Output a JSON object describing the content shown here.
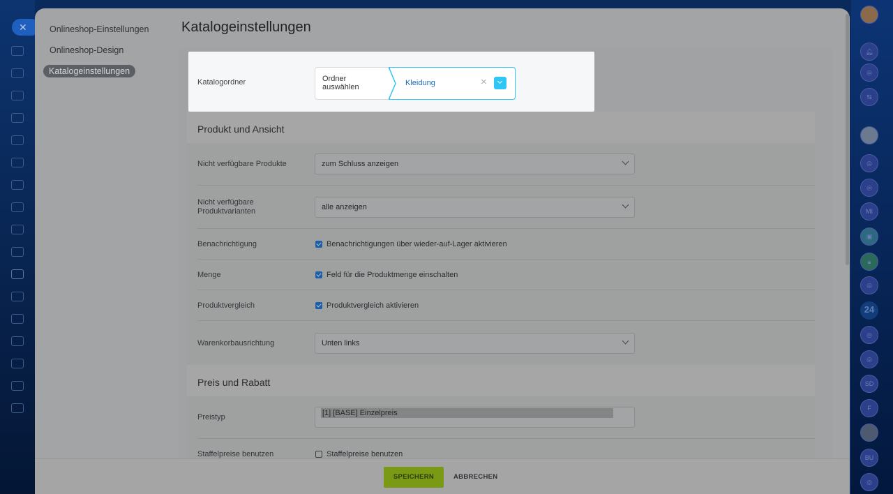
{
  "left_menu": {
    "items": [
      {
        "label": "Onlineshop-Einstellungen"
      },
      {
        "label": "Onlineshop-Design"
      },
      {
        "label": "Katalogeinstellungen",
        "active": true
      }
    ]
  },
  "page_title": "Katalogeinstellungen",
  "catalog_folder": {
    "label": "Katalogordner",
    "selector_label": "Ordner auswählen",
    "value": "Kleidung"
  },
  "section_product": {
    "title": "Produkt und Ansicht",
    "unavailable_products": {
      "label": "Nicht verfügbare Produkte",
      "value": "zum Schluss anzeigen"
    },
    "unavailable_variants": {
      "label": "Nicht verfügbare Produktvarianten",
      "value": "alle anzeigen"
    },
    "notification": {
      "label": "Benachrichtigung",
      "checkbox": "Benachrichtigungen über wieder-auf-Lager aktivieren",
      "checked": true
    },
    "quantity": {
      "label": "Menge",
      "checkbox": "Feld für die Produktmenge einschalten",
      "checked": true
    },
    "compare": {
      "label": "Produktvergleich",
      "checkbox": "Produktvergleich aktivieren",
      "checked": true
    },
    "cart_position": {
      "label": "Warenkorbausrichtung",
      "value": "Unten links"
    }
  },
  "section_price": {
    "title": "Preis und Rabatt",
    "price_type": {
      "label": "Preistyp",
      "value": "[1] [BASE] Einzelpreis"
    },
    "tier_prices": {
      "label": "Staffelpreise benutzen",
      "checkbox": "Staffelpreise benutzen",
      "checked": false
    }
  },
  "footer": {
    "save": "SPEICHERN",
    "cancel": "ABBRECHEN"
  },
  "right_bar": {
    "badges": [
      "MI",
      "24",
      "SD",
      "F",
      "BU"
    ]
  },
  "colors": {
    "accent": "#2fc6f6",
    "save": "#9dc21c",
    "link": "#2067b0"
  }
}
